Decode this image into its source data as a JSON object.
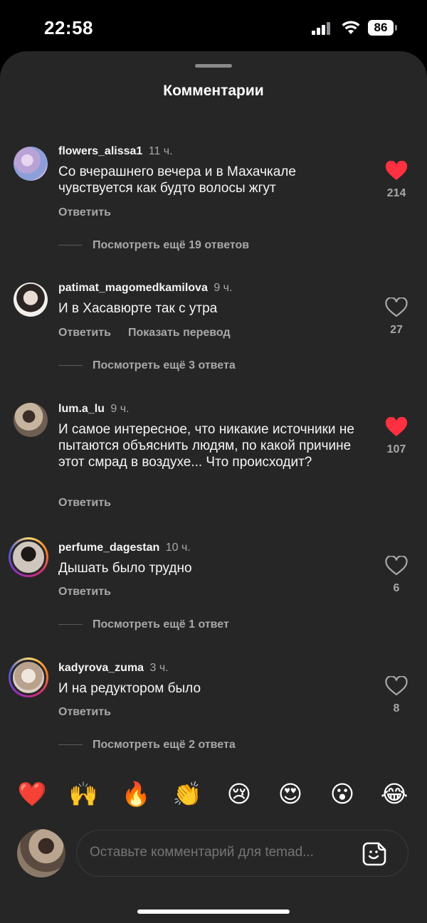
{
  "status": {
    "time": "22:58",
    "battery": "86"
  },
  "sheet": {
    "title": "Комментарии"
  },
  "comments": [
    {
      "username": "flowers_alissa1",
      "ago": "11 ч.",
      "text": "Со вчерашнего вечера и в Махачкале чувствуется как будто волосы жгут",
      "reply": "Ответить",
      "likes": "214",
      "liked": true,
      "view_more": "Посмотреть ещё 19 ответов"
    },
    {
      "username": "patimat_magomedkamilova",
      "ago": "9 ч.",
      "text": "И в Хасавюрте так с утра",
      "reply": "Ответить",
      "translate": "Показать перевод",
      "likes": "27",
      "liked": false,
      "view_more": "Посмотреть ещё 3 ответа"
    },
    {
      "username": "lum.a_lu",
      "ago": "9 ч.",
      "text": "И самое интересное, что никакие источники не пытаются объяснить людям, по какой причине этот смрад в воздухе... Что происходит?",
      "reply": "Ответить",
      "likes": "107",
      "liked": true
    },
    {
      "username": "perfume_dagestan",
      "ago": "10 ч.",
      "text": "Дышать было трудно",
      "reply": "Ответить",
      "likes": "6",
      "liked": false,
      "view_more": "Посмотреть ещё 1 ответ"
    },
    {
      "username": "kadyrova_zuma",
      "ago": "3 ч.",
      "text": "И на редуктором было",
      "reply": "Ответить",
      "likes": "8",
      "liked": false,
      "view_more": "Посмотреть ещё 2 ответа"
    }
  ],
  "reactions": [
    "❤️",
    "🙌",
    "🔥",
    "👏",
    "😢",
    "😍",
    "😮",
    "😂"
  ],
  "composer": {
    "placeholder": "Оставьте комментарий для temad..."
  },
  "colors": {
    "like_active": "#ff3040",
    "sheet_bg": "#262626",
    "muted_text": "#a8a8a8"
  },
  "icons": {
    "like": "heart-icon",
    "sticker": "sticker-icon",
    "wifi": "wifi-icon",
    "signal": "cellular-signal-icon"
  }
}
